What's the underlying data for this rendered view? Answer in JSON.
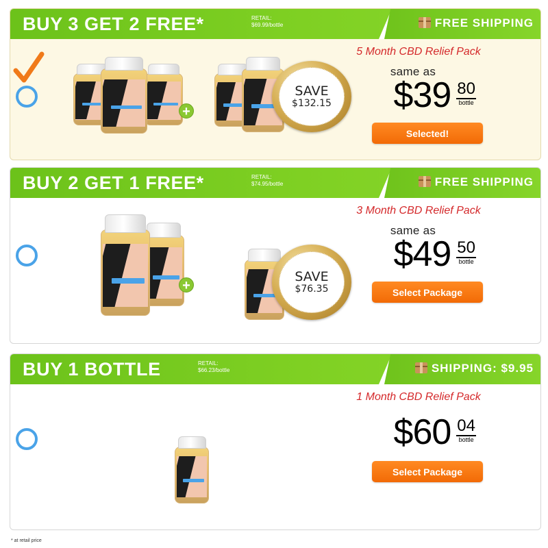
{
  "packages": [
    {
      "title": "BUY 3 GET 2 FREE*",
      "retail_label": "RETAIL:",
      "retail_value": "$69.99/bottle",
      "shipping": "FREE SHIPPING",
      "pack_name": "5 Month CBD Relief Pack",
      "same_as": "same as",
      "price_dollars": "$39",
      "price_cents": "80",
      "per": "bottle",
      "save_word": "SAVE",
      "save_amount": "$132.15",
      "button": "Selected!",
      "selected": true,
      "paid_bottles": 3,
      "free_bottles": 2
    },
    {
      "title": "BUY 2 GET 1 FREE*",
      "retail_label": "RETAIL:",
      "retail_value": "$74.95/bottle",
      "shipping": "FREE SHIPPING",
      "pack_name": "3 Month CBD Relief Pack",
      "same_as": "same as",
      "price_dollars": "$49",
      "price_cents": "50",
      "per": "bottle",
      "save_word": "SAVE",
      "save_amount": "$76.35",
      "button": "Select Package",
      "selected": false,
      "paid_bottles": 2,
      "free_bottles": 1
    },
    {
      "title": "BUY 1 BOTTLE",
      "retail_label": "RETAIL:",
      "retail_value": "$66.23/bottle",
      "shipping": "SHIPPING: $9.95",
      "pack_name": "1 Month CBD Relief Pack",
      "price_dollars": "$60",
      "price_cents": "04",
      "per": "bottle",
      "button": "Select Package",
      "selected": false,
      "paid_bottles": 1,
      "free_bottles": 0
    }
  ],
  "footnote": "* at retail price",
  "colors": {
    "header_green": "#7fd023",
    "button_orange": "#f26a06",
    "pack_red": "#d4282a",
    "radio_blue": "#4aa3e8",
    "check_orange": "#f07a1a",
    "selected_bg": "#fdf8e4"
  },
  "icons": [
    "checkmark-icon",
    "radio-circle-icon",
    "shipping-box-icon",
    "plus-icon",
    "save-badge-icon"
  ]
}
